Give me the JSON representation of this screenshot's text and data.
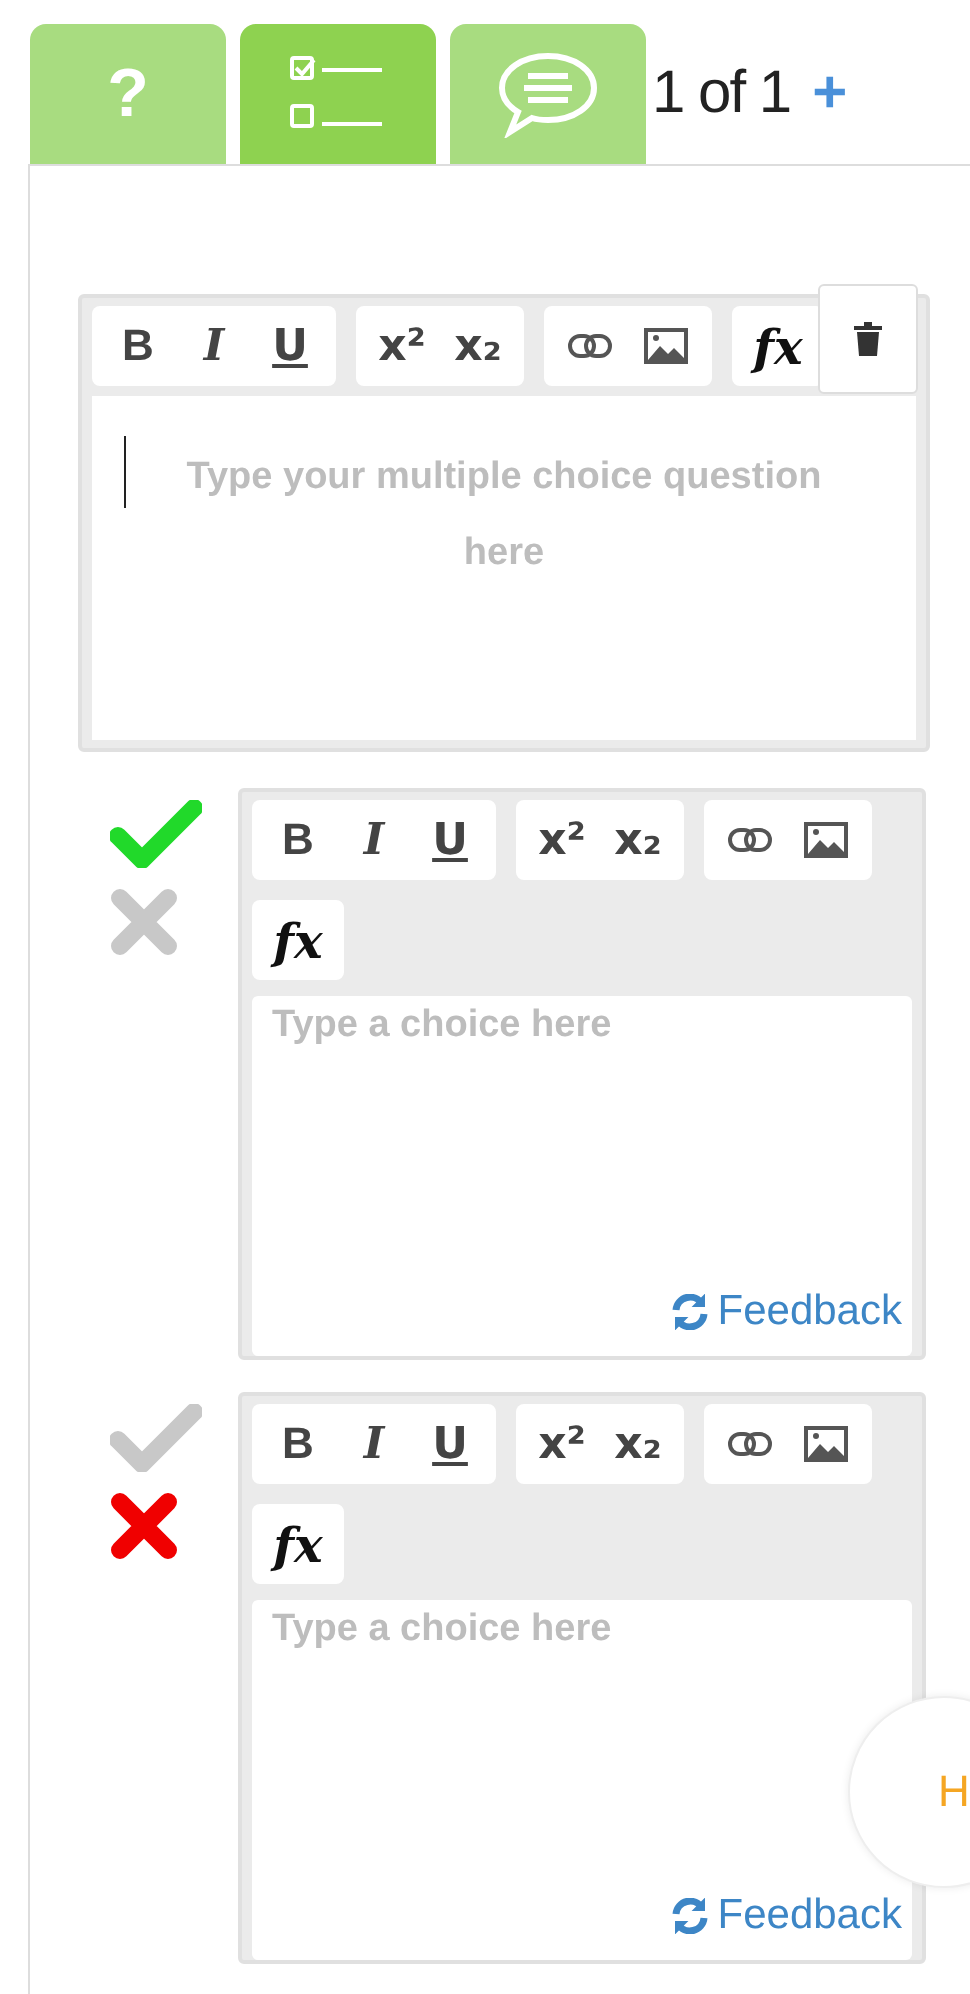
{
  "tabs": [
    {
      "kind": "help",
      "label": "?",
      "selected": false
    },
    {
      "kind": "choices",
      "selected": true
    },
    {
      "kind": "comment",
      "selected": false
    }
  ],
  "counter": {
    "text": "1 of 1",
    "add": "+"
  },
  "question": {
    "toolbar": [
      [
        "B",
        "I",
        "U"
      ],
      [
        "x²",
        "x₂"
      ],
      [
        "fx"
      ]
    ],
    "placeholder": "Type your multiple choice question here"
  },
  "choices": [
    {
      "correct": true,
      "toolbar": [
        [
          "B",
          "I",
          "U"
        ],
        [
          "x²",
          "x₂"
        ],
        [
          "fx"
        ]
      ],
      "placeholder": "Type a choice here",
      "feedback": "Feedback"
    },
    {
      "correct": false,
      "toolbar": [
        [
          "B",
          "I",
          "U"
        ],
        [
          "x²",
          "x₂"
        ],
        [
          "fx"
        ]
      ],
      "placeholder": "Type a choice here",
      "feedback": "Feedback"
    }
  ],
  "help_bubble": {
    "label": "H"
  }
}
